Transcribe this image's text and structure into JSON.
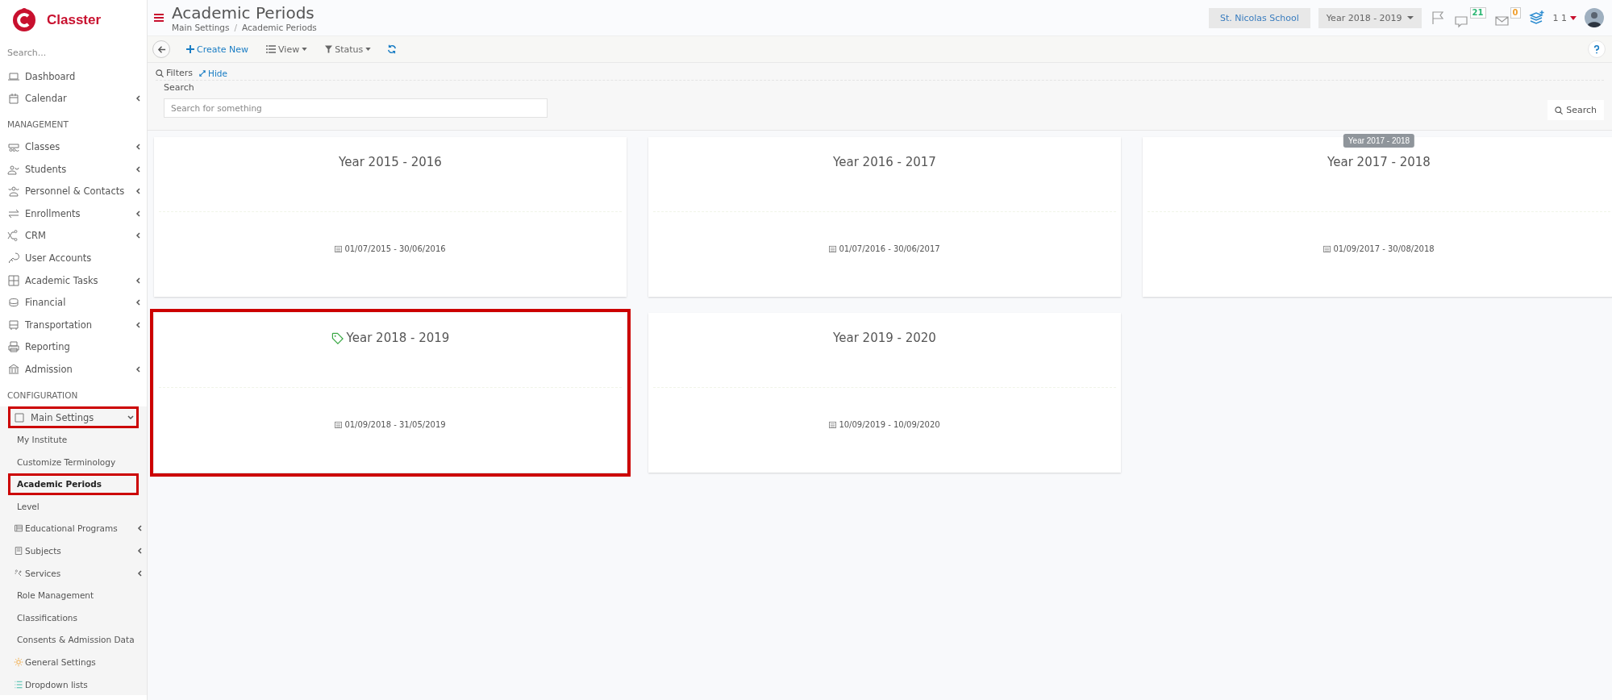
{
  "sidebar": {
    "brand": "Classter",
    "search": {
      "placeholder": "Search..."
    },
    "sections": [
      {
        "items": [
          {
            "label": "Dashboard",
            "has_submenu": false
          },
          {
            "label": "Calendar",
            "has_submenu": true
          }
        ]
      },
      {
        "heading": "MANAGEMENT",
        "items": [
          {
            "label": "Classes",
            "has_submenu": true
          },
          {
            "label": "Students",
            "has_submenu": true
          },
          {
            "label": "Personnel & Contacts",
            "has_submenu": true
          },
          {
            "label": "Enrollments",
            "has_submenu": true
          },
          {
            "label": "CRM",
            "has_submenu": true
          },
          {
            "label": "User Accounts",
            "has_submenu": false
          },
          {
            "label": "Academic Tasks",
            "has_submenu": true
          },
          {
            "label": "Financial",
            "has_submenu": true
          },
          {
            "label": "Transportation",
            "has_submenu": true
          },
          {
            "label": "Reporting",
            "has_submenu": false
          },
          {
            "label": "Admission",
            "has_submenu": true
          }
        ]
      },
      {
        "heading": "CONFIGURATION",
        "items": [
          {
            "label": "Main Settings",
            "has_submenu": true,
            "expanded": true,
            "highlighted": true,
            "children": [
              {
                "label": "My Institute",
                "selected": false,
                "highlighted": false,
                "has_submenu": false
              },
              {
                "label": "Customize Terminology",
                "selected": false,
                "highlighted": false,
                "has_submenu": false
              },
              {
                "label": "Academic Periods",
                "selected": true,
                "highlighted": true,
                "has_submenu": false
              },
              {
                "label": "Level",
                "selected": false,
                "highlighted": false,
                "has_submenu": false
              },
              {
                "label": "Educational Programs",
                "selected": false,
                "highlighted": false,
                "has_submenu": true
              },
              {
                "label": "Subjects",
                "selected": false,
                "highlighted": false,
                "has_submenu": true
              },
              {
                "label": "Services",
                "selected": false,
                "highlighted": false,
                "has_submenu": true
              },
              {
                "label": "Role Management",
                "selected": false,
                "highlighted": false,
                "has_submenu": false
              },
              {
                "label": "Classifications",
                "selected": false,
                "highlighted": false,
                "has_submenu": false
              },
              {
                "label": "Consents & Admission Data",
                "selected": false,
                "highlighted": false,
                "has_submenu": false
              },
              {
                "label": "General Settings",
                "selected": false,
                "highlighted": false,
                "has_submenu": false
              },
              {
                "label": "Dropdown lists",
                "selected": false,
                "highlighted": false,
                "has_submenu": false
              }
            ]
          }
        ]
      }
    ]
  },
  "header": {
    "title": "Academic Periods",
    "breadcrumb": [
      "Main Settings",
      "Academic Periods"
    ],
    "breadcrumb_separator": "/",
    "school": "St. Nicolas School",
    "year": "Year 2018 - 2019",
    "notifications": [
      {
        "count": "21",
        "color": "#2bb673"
      },
      {
        "count": "0",
        "color": "#f0a030"
      }
    ],
    "user": "1 1"
  },
  "toolbar": {
    "buttons": [
      {
        "label": "Create New",
        "kind": "create"
      },
      {
        "label": "View",
        "kind": "dropdown"
      },
      {
        "label": "Status",
        "kind": "dropdown"
      }
    ]
  },
  "filters": {
    "label": "Filters",
    "toggle": "Hide",
    "search_label": "Search",
    "placeholder": "Search for something",
    "button": "Search"
  },
  "periods": [
    {
      "title": "Year 2015 - 2016",
      "dates": "01/07/2015 - 30/06/2016",
      "current": false,
      "highlighted": false
    },
    {
      "title": "Year 2016 - 2017",
      "dates": "01/07/2016 - 30/06/2017",
      "current": false,
      "highlighted": false
    },
    {
      "title": "Year 2017 - 2018",
      "dates": "01/09/2017 - 30/08/2018",
      "current": false,
      "highlighted": false,
      "tooltip": "Year 2017 - 2018"
    },
    {
      "title": "Year 2018 - 2019",
      "dates": "01/09/2018 - 31/05/2019",
      "current": true,
      "highlighted": true
    },
    {
      "title": "Year 2019 - 2020",
      "dates": "10/09/2019 - 10/09/2020",
      "current": false,
      "highlighted": false
    }
  ]
}
